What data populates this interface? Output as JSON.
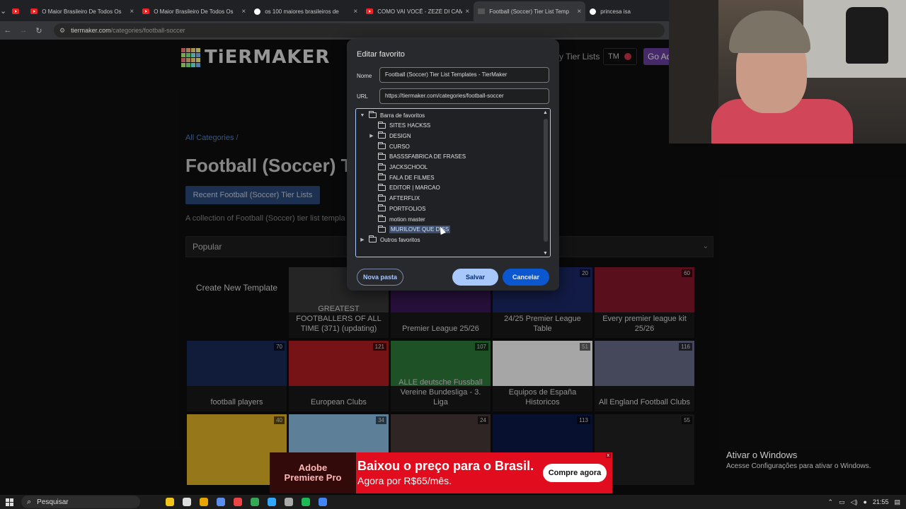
{
  "browser": {
    "tabs": [
      {
        "title": "",
        "kind": "yt"
      },
      {
        "title": "O Maior Brasileiro De Todos Os",
        "kind": "yt"
      },
      {
        "title": "O Maior Brasileiro De Todos Os",
        "kind": "yt"
      },
      {
        "title": "os 100 maiores brasileiros de",
        "kind": "g"
      },
      {
        "title": "COMO VAI VOCÊ - ZEZÉ DI CAM",
        "kind": "yt"
      },
      {
        "title": "Football (Soccer) Tier List Temp",
        "kind": "tm",
        "active": true
      },
      {
        "title": "princesa isa",
        "kind": "g"
      }
    ],
    "url_host": "tiermaker.com",
    "url_path": "/categories/football-soccer"
  },
  "site": {
    "logo": "TiERMAKER",
    "logo_colors": [
      "#ff7f7f",
      "#ffbf7f",
      "#ffdf7f",
      "#ffff7f",
      "#bfff7f",
      "#7fff7f",
      "#7fffff",
      "#7fbfff",
      "#ff7f7f",
      "#ffbf7f",
      "#ffdf7f",
      "#ffff7f",
      "#bfff7f",
      "#7fff7f",
      "#7fffff",
      "#7fbfff"
    ],
    "my_tier_lists": "y Tier Lists",
    "user_initials": "TM",
    "go_ad": "Go Ad",
    "breadcrumb": "All Categories /",
    "title": "Football (Soccer) T",
    "recent_button": "Recent Football (Soccer) Tier Lists",
    "description": "A collection of Football (Soccer) tier list templa",
    "sort_value": "Popular",
    "cards": [
      {
        "name": "Create New Template",
        "count": "",
        "create": true,
        "color": ""
      },
      {
        "name": "GREATEST FOOTBALLERS OF ALL TIME (371) (updating)",
        "count": "",
        "color": "#3a3a3a"
      },
      {
        "name": "Premier League 25/26",
        "count": "",
        "color": "#3d195b"
      },
      {
        "name": "24/25 Premier League Table",
        "count": "20",
        "color": "#1c2a6b"
      },
      {
        "name": "Every premier league kit 25/26",
        "count": "60",
        "color": "#8b1a2b"
      },
      {
        "name": "football players",
        "count": "70",
        "color": "#1b2a5a"
      },
      {
        "name": "European Clubs",
        "count": "121",
        "color": "#b51e24"
      },
      {
        "name": "ALLE deutsche Fussball Vereine Bundesliga - 3. Liga",
        "count": "107",
        "color": "#2f7d3a"
      },
      {
        "name": "Equipos de España Historicos",
        "count": "51",
        "color": "#ffffff"
      },
      {
        "name": "All England Football Clubs",
        "count": "116",
        "color": "#6a6f8a"
      },
      {
        "name": "",
        "count": "40",
        "color": "#e6b82a"
      },
      {
        "name": "",
        "count": "34",
        "color": "#8fc3e8"
      },
      {
        "name": "",
        "count": "24",
        "color": "#4a3a3a"
      },
      {
        "name": "",
        "count": "113",
        "color": "#0d1a4a"
      },
      {
        "name": "",
        "count": "55",
        "color": "#222222"
      }
    ]
  },
  "dialog": {
    "title": "Editar favorito",
    "name_label": "Nome",
    "name_value": "Football (Soccer) Tier List Templates - TierMaker",
    "url_label": "URL",
    "url_value": "https://tiermaker.com/categories/football-soccer",
    "tree": [
      {
        "label": "Barra de favoritos",
        "level": 0,
        "twisty": "open"
      },
      {
        "label": "SITES HACKSS",
        "level": 1,
        "twisty": ""
      },
      {
        "label": "DESIGN",
        "level": 1,
        "twisty": "closed"
      },
      {
        "label": "CURSO",
        "level": 1,
        "twisty": ""
      },
      {
        "label": "BASSSFABRICA DE FRASES",
        "level": 1,
        "twisty": ""
      },
      {
        "label": "JACKSCHOOL",
        "level": 1,
        "twisty": ""
      },
      {
        "label": "FALA DE FILMES",
        "level": 1,
        "twisty": ""
      },
      {
        "label": "EDITOR | MARCAO",
        "level": 1,
        "twisty": ""
      },
      {
        "label": "AFTERFLIX",
        "level": 1,
        "twisty": ""
      },
      {
        "label": "PORTFOLIOS",
        "level": 1,
        "twisty": ""
      },
      {
        "label": "motion master",
        "level": 1,
        "twisty": ""
      },
      {
        "label": "MURILOVE QUE DISS",
        "level": 1,
        "twisty": "",
        "selected": true
      },
      {
        "label": "Outros favoritos",
        "level": 0,
        "twisty": "closed"
      }
    ],
    "new_folder": "Nova pasta",
    "save": "Salvar",
    "cancel": "Cancelar"
  },
  "ad": {
    "brand_top": "Adobe",
    "brand_bottom": "Premiere Pro",
    "headline": "Baixou o preço para o Brasil.",
    "sub": "Agora por R$65/mês.",
    "cta": "Compre agora",
    "x": "x"
  },
  "activate": {
    "line1": "Ativar o Windows",
    "line2": "Acesse Configurações para ativar o Windows."
  },
  "taskbar": {
    "search_placeholder": "Pesquisar",
    "time": "21:55",
    "apps": [
      "#f0c419",
      "#ddd",
      "#e8a400",
      "#5a8dee",
      "#e44",
      "#34a853",
      "#31a8ff",
      "#aaa",
      "#1db954",
      "#4285f4"
    ]
  }
}
